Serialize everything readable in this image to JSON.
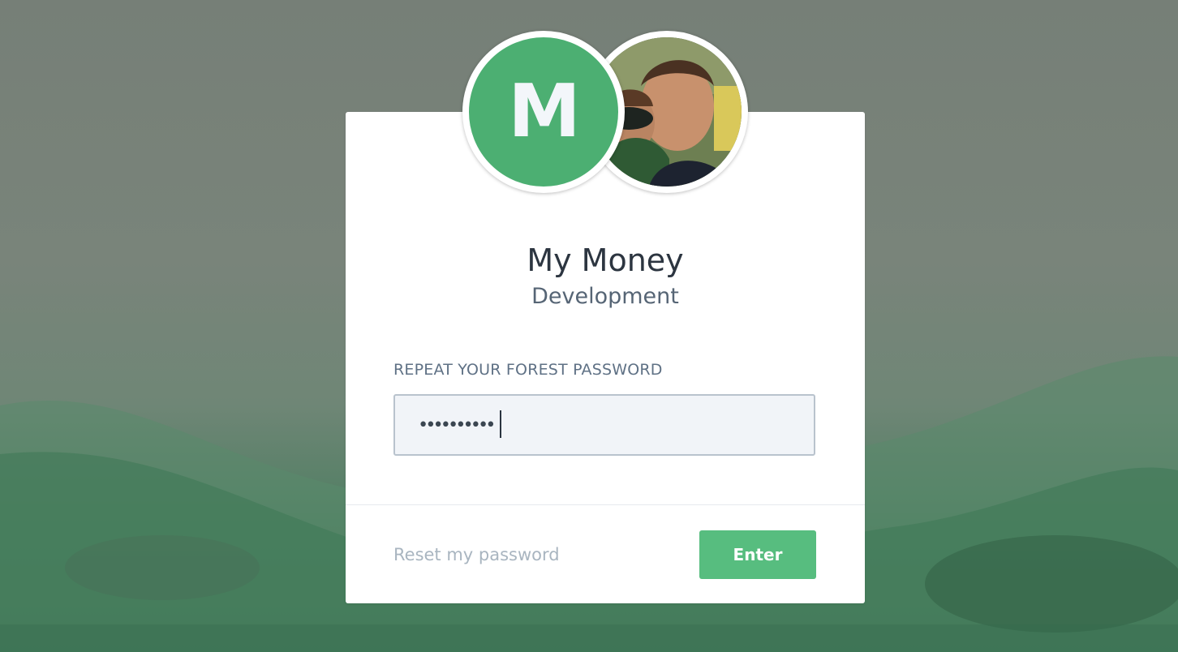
{
  "app": {
    "logo_letter": "M",
    "title": "My Money",
    "subtitle": "Development"
  },
  "login": {
    "field_label": "REPEAT YOUR FOREST PASSWORD",
    "password_value": "••••••••••",
    "reset_label": "Reset my password",
    "enter_label": "Enter"
  },
  "colors": {
    "accent": "#57bd7f",
    "logo_bg": "#4caf72"
  }
}
